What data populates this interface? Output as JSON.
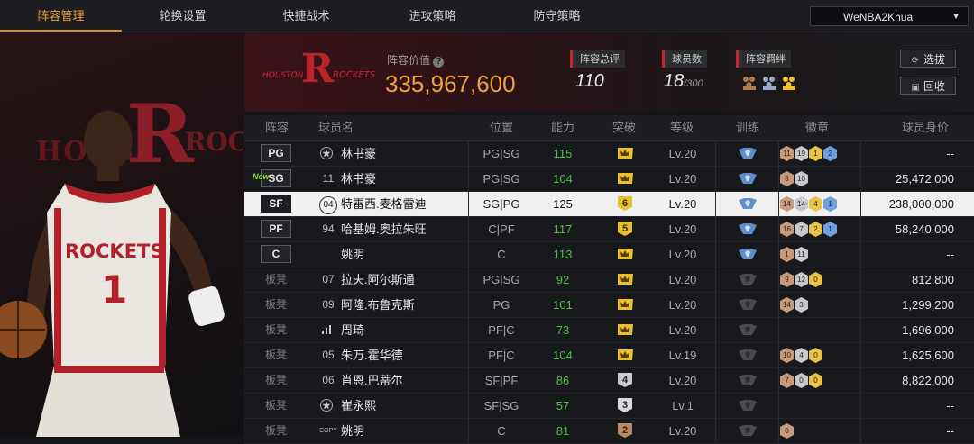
{
  "tabs": [
    {
      "label": "阵容管理",
      "active": true
    },
    {
      "label": "轮换设置",
      "active": false
    },
    {
      "label": "快捷战术",
      "active": false
    },
    {
      "label": "进攻策略",
      "active": false
    },
    {
      "label": "防守策略",
      "active": false
    }
  ],
  "user": {
    "name": "WeNBA2Khua"
  },
  "team": {
    "logo_text": "HOUSTON ROCKETS",
    "logo_letter": "R"
  },
  "header": {
    "value_label": "阵容价值",
    "value": "335,967,600",
    "rating_label": "阵容总评",
    "rating": "110",
    "count_label": "球员数",
    "count": "18",
    "count_max": "/300",
    "bond_label": "阵容羁绊",
    "btn_select": "选拔",
    "btn_recycle": "回收"
  },
  "table": {
    "headers": [
      "阵容",
      "球员名",
      "位置",
      "能力",
      "突破",
      "等级",
      "训练",
      "徽章",
      "球员身价"
    ],
    "rows": [
      {
        "slot": "PG",
        "starter": true,
        "new": false,
        "num": "",
        "icon": "star",
        "name": "林书豪",
        "pos": "PG|SG",
        "ab": "115",
        "brk": "crown",
        "lv": "Lv.20",
        "train": true,
        "badges": [
          "11",
          "19",
          "1",
          "2"
        ],
        "worth": "--",
        "hl": false
      },
      {
        "slot": "SG",
        "starter": true,
        "new": true,
        "num": "11",
        "icon": "",
        "name": "林书豪",
        "pos": "PG|SG",
        "ab": "104",
        "brk": "crown",
        "lv": "Lv.20",
        "train": true,
        "badges": [
          "8",
          "10"
        ],
        "worth": "25,472,000",
        "hl": false
      },
      {
        "slot": "SF",
        "starter": true,
        "new": false,
        "num": "04",
        "icon": "ring",
        "name": "特雷西.麦格雷迪",
        "pos": "SG|PG",
        "ab": "125",
        "brk": "6",
        "lv": "Lv.20",
        "train": true,
        "badges": [
          "14",
          "14",
          "4",
          "1"
        ],
        "worth": "238,000,000",
        "hl": true
      },
      {
        "slot": "PF",
        "starter": true,
        "new": false,
        "num": "94",
        "icon": "",
        "name": "哈基姆.奥拉朱旺",
        "pos": "C|PF",
        "ab": "117",
        "brk": "5",
        "lv": "Lv.20",
        "train": true,
        "badges": [
          "16",
          "7",
          "2",
          "1"
        ],
        "worth": "58,240,000",
        "hl": false
      },
      {
        "slot": "C",
        "starter": true,
        "new": false,
        "num": "",
        "icon": "",
        "name": "姚明",
        "pos": "C",
        "ab": "113",
        "brk": "crown",
        "lv": "Lv.20",
        "train": true,
        "badges": [
          "1",
          "11"
        ],
        "worth": "--",
        "hl": false
      },
      {
        "slot": "板凳",
        "starter": false,
        "new": false,
        "num": "07",
        "icon": "",
        "name": "拉夫.阿尔斯通",
        "pos": "PG|SG",
        "ab": "92",
        "brk": "crown",
        "lv": "Lv.20",
        "train": false,
        "badges": [
          "9",
          "12",
          "0"
        ],
        "worth": "812,800",
        "hl": false
      },
      {
        "slot": "板凳",
        "starter": false,
        "new": false,
        "num": "09",
        "icon": "",
        "name": "阿隆.布鲁克斯",
        "pos": "PG",
        "ab": "101",
        "brk": "crown",
        "lv": "Lv.20",
        "train": false,
        "badges": [
          "14",
          "3"
        ],
        "worth": "1,299,200",
        "hl": false
      },
      {
        "slot": "板凳",
        "starter": false,
        "new": false,
        "num": "",
        "icon": "bars",
        "name": "周琦",
        "pos": "PF|C",
        "ab": "73",
        "brk": "crown",
        "lv": "Lv.20",
        "train": false,
        "badges": [],
        "worth": "1,696,000",
        "hl": false
      },
      {
        "slot": "板凳",
        "starter": false,
        "new": false,
        "num": "05",
        "icon": "",
        "name": "朱万.霍华德",
        "pos": "PF|C",
        "ab": "104",
        "brk": "crown",
        "lv": "Lv.19",
        "train": false,
        "badges": [
          "10",
          "4",
          "0"
        ],
        "worth": "1,625,600",
        "hl": false
      },
      {
        "slot": "板凳",
        "starter": false,
        "new": false,
        "num": "06",
        "icon": "",
        "name": "肖恩.巴蒂尔",
        "pos": "SF|PF",
        "ab": "86",
        "brk": "4",
        "lv": "Lv.20",
        "train": false,
        "badges": [
          "7",
          "0",
          "0"
        ],
        "worth": "8,822,000",
        "hl": false
      },
      {
        "slot": "板凳",
        "starter": false,
        "new": false,
        "num": "",
        "icon": "star",
        "name": "崔永熙",
        "pos": "SF|SG",
        "ab": "57",
        "brk": "3",
        "lv": "Lv.1",
        "train": false,
        "badges": [],
        "worth": "--",
        "hl": false
      },
      {
        "slot": "板凳",
        "starter": false,
        "new": false,
        "num": "COPY",
        "icon": "",
        "name": "姚明",
        "pos": "C",
        "ab": "81",
        "brk": "2",
        "lv": "Lv.20",
        "train": false,
        "badges": [
          "0"
        ],
        "worth": "--",
        "hl": false
      }
    ]
  },
  "labels": {
    "new_tag": "New"
  },
  "colors": {
    "accent": "#f0a23c",
    "brand_red": "#c8282d",
    "ability_green": "#4fbf4a"
  }
}
